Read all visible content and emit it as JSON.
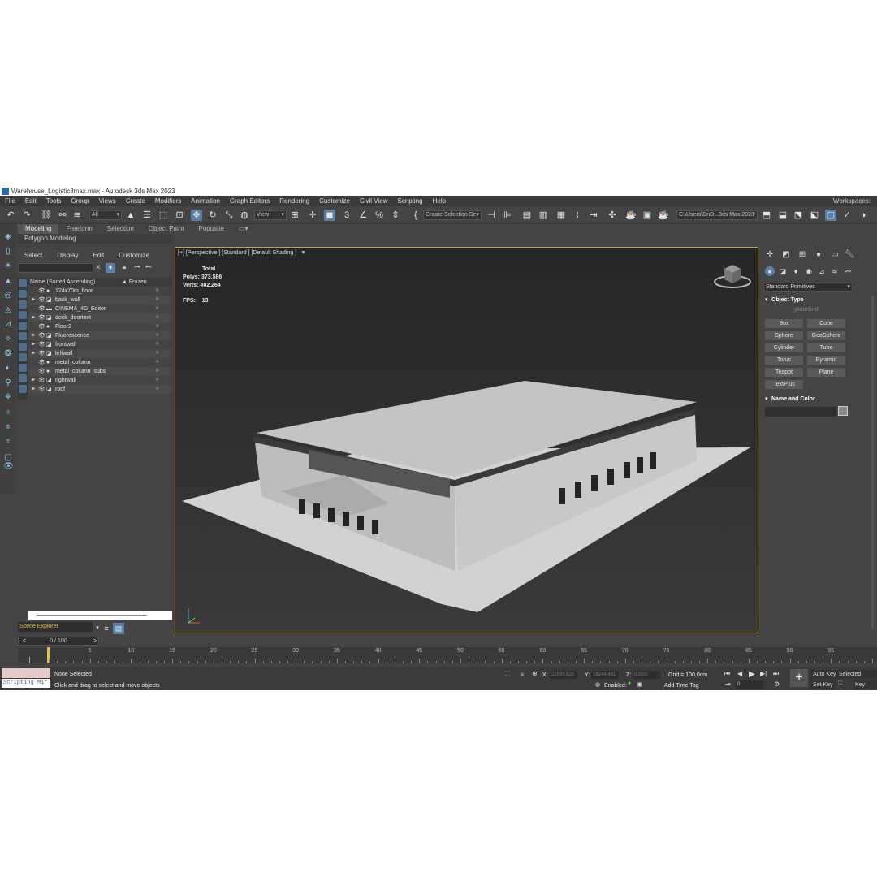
{
  "window": {
    "title": "Warehouse_Logistic8max.max - Autodesk 3ds Max 2023"
  },
  "menu": [
    "File",
    "Edit",
    "Tools",
    "Group",
    "Views",
    "Create",
    "Modifiers",
    "Animation",
    "Graph Editors",
    "Rendering",
    "Customize",
    "Civil View",
    "Scripting",
    "Help"
  ],
  "workspaces_label": "Workspaces:",
  "toolbar": {
    "filter_value": "All",
    "refcoord_value": "View",
    "selection_set_value": "Create Selection Se",
    "project_path": "C:\\Users\\DnD...3ds Max 2023"
  },
  "ribbon": {
    "tabs": [
      "Modeling",
      "Freeform",
      "Selection",
      "Object Paint",
      "Populate"
    ],
    "active": "Modeling",
    "panel_label": "Polygon Modeling"
  },
  "explorer": {
    "menu": [
      "Select",
      "Display",
      "Edit",
      "Customize"
    ],
    "col_name": "Name (Sorted Ascending)",
    "col_frozen": "▲ Frozen",
    "items": [
      {
        "name": "124x70m_floor",
        "expand": false,
        "type": "sphere"
      },
      {
        "name": "back_wall",
        "expand": true,
        "type": "poly"
      },
      {
        "name": "CINEMA_4D_Editor",
        "expand": false,
        "type": "camera"
      },
      {
        "name": "dock_doortext",
        "expand": true,
        "type": "poly"
      },
      {
        "name": "Floor2",
        "expand": false,
        "type": "sphere"
      },
      {
        "name": "Fluorescence",
        "expand": true,
        "type": "poly"
      },
      {
        "name": "frontwall",
        "expand": true,
        "type": "poly"
      },
      {
        "name": "leftwall",
        "expand": true,
        "type": "poly"
      },
      {
        "name": "metal_column",
        "expand": false,
        "type": "sphere"
      },
      {
        "name": "metal_column_subs",
        "expand": false,
        "type": "sphere"
      },
      {
        "name": "rightwall",
        "expand": true,
        "type": "poly"
      },
      {
        "name": "roof",
        "expand": true,
        "type": "poly"
      }
    ],
    "bottom_dropdown": "Scene Explorer"
  },
  "viewport": {
    "label": "[+] [Perspective ] [Standard ] [Default Shading ]",
    "stats_header": "Total",
    "polys_label": "Polys:",
    "polys_value": "373.586",
    "verts_label": "Verts:",
    "verts_value": "402.264",
    "fps_label": "FPS:",
    "fps_value": "13"
  },
  "command_panel": {
    "category": "Standard Primitives",
    "object_type_title": "Object Type",
    "autogrid": "AutoGrid",
    "buttons": [
      "Box",
      "Cone",
      "Sphere",
      "GeoSphere",
      "Cylinder",
      "Tube",
      "Torus",
      "Pyramid",
      "Teapot",
      "Plane",
      "TextPlus"
    ],
    "name_color_title": "Name and Color"
  },
  "timeline": {
    "frame_display": "0 / 100",
    "ticks": [
      "0",
      "5",
      "10",
      "15",
      "20",
      "25",
      "30",
      "35",
      "40",
      "45",
      "50",
      "55",
      "60",
      "65",
      "70",
      "75",
      "80",
      "85",
      "90",
      "95"
    ]
  },
  "status": {
    "script_label": "Scripting Mir",
    "selection": "None Selected",
    "prompt": "Click and drag to select and move objects",
    "x_label": "X:",
    "x_value": "22899,625",
    "y_label": "Y:",
    "y_value": "16244,461",
    "z_label": "Z:",
    "z_value": "0,0cm",
    "grid": "Grid = 100,0cm",
    "enabled": "Enabled:",
    "add_time_tag": "Add Time Tag",
    "auto_key": "Auto Key",
    "selected": "Selected",
    "set_key": "Set Key",
    "key_filters": "Key Filter",
    "frame_field": "0"
  },
  "colors": {
    "viewport_border": "#c7a94a",
    "active_button": "#5b7fa6",
    "panel_bg": "#444444"
  }
}
